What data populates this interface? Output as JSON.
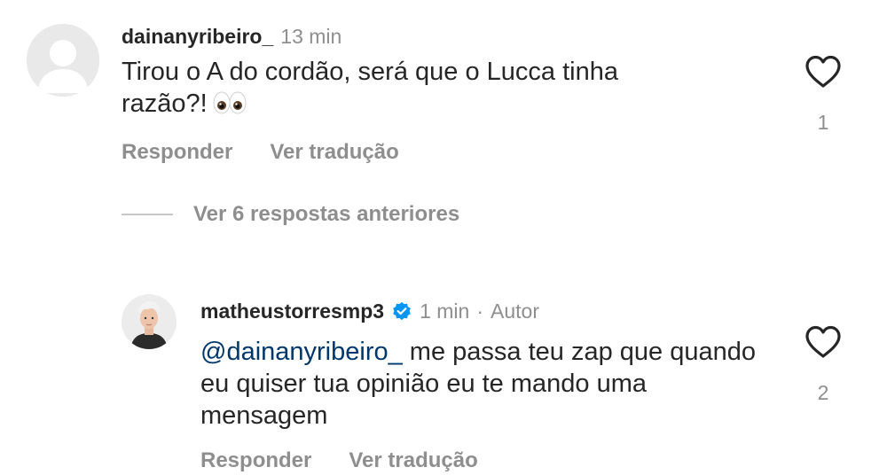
{
  "comment": {
    "username": "dainanyribeiro_",
    "time": "13 min",
    "text": "Tirou o A do cordão, será que o Lucca tinha razão?!",
    "emoji": "eyes-emoji",
    "likes": "1",
    "reply_label": "Responder",
    "translate_label": "Ver tradução"
  },
  "view_replies_label": "Ver 6 respostas anteriores",
  "reply": {
    "username": "matheustorresmp3",
    "verified": true,
    "time": "1 min",
    "separator": "·",
    "author_tag": "Autor",
    "mention": "@dainanyribeiro_",
    "text": " me passa teu zap que quando eu quiser tua opinião eu te mando uma mensagem",
    "likes": "2",
    "reply_label": "Responder",
    "translate_label": "Ver tradução"
  },
  "colors": {
    "text": "#262626",
    "secondary": "#8e8e8e",
    "mention": "#00376b",
    "verified": "#0095f6"
  },
  "icons": [
    "default-avatar-icon",
    "heart-icon",
    "verified-badge-icon",
    "eyes-emoji"
  ]
}
